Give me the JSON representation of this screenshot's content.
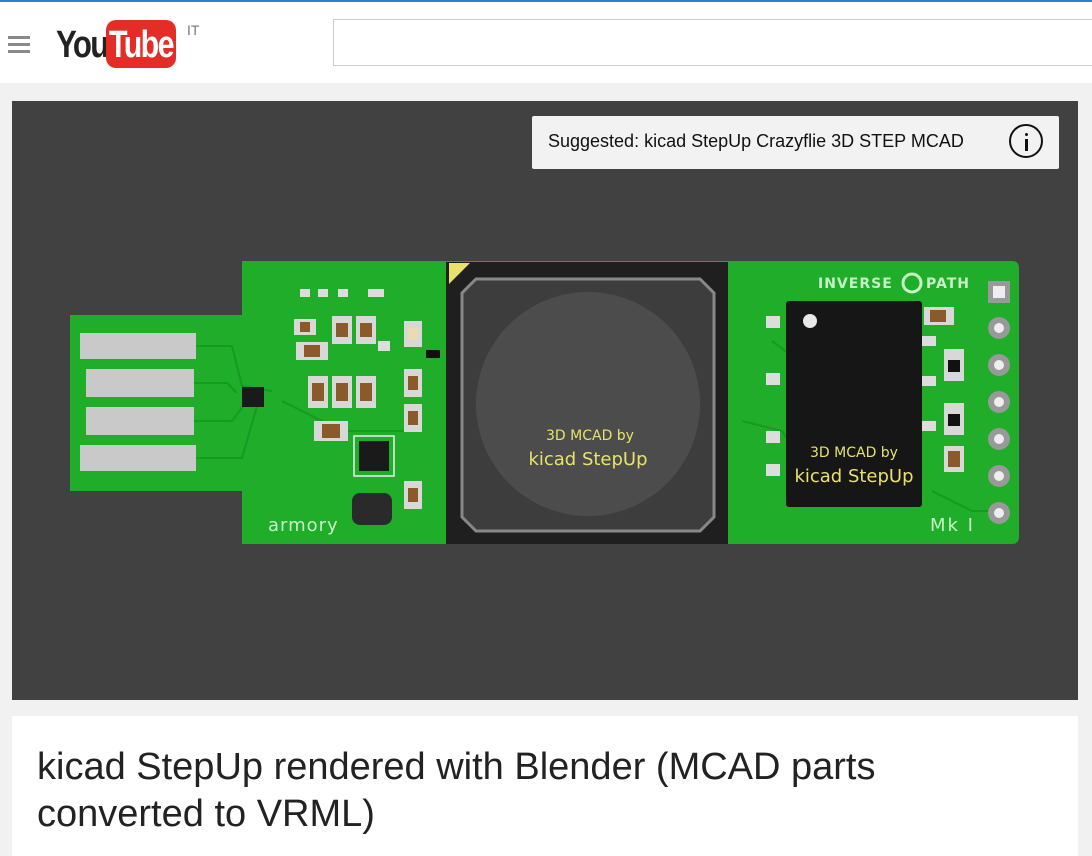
{
  "header": {
    "logo_text_you": "You",
    "logo_text_tube": "Tube",
    "country_code": "IT",
    "search_placeholder": ""
  },
  "player": {
    "suggestion_text": "Suggested: kicad StepUp Crazyflie 3D STEP MCAD",
    "board": {
      "big_chip_line1": "3D MCAD by",
      "big_chip_line2": "kicad StepUp",
      "small_chip_line1": "3D MCAD by",
      "small_chip_line2": "kicad StepUp",
      "silk_left": "armory",
      "silk_logo": "INVERSE",
      "silk_logo_right": "PATH",
      "silk_rev": "Mk I"
    }
  },
  "video": {
    "title": "kicad StepUp rendered with Blender (MCAD parts converted to VRML)"
  },
  "colors": {
    "brand_red": "#e52d27",
    "pcb_green": "#1fad2a",
    "player_bg": "#414141"
  }
}
